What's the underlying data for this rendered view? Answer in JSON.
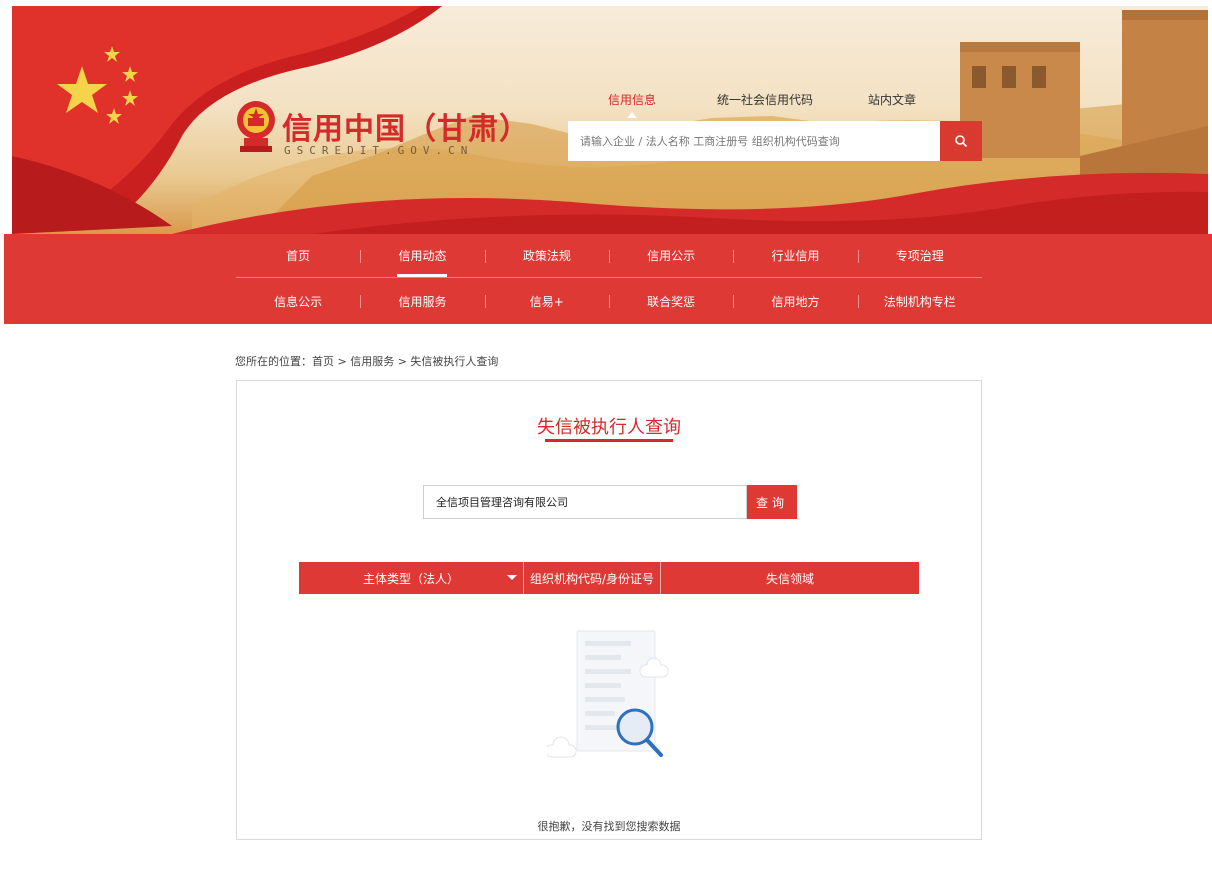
{
  "header": {
    "logo_title": "信用中国（甘肃）",
    "logo_sub": "GSCREDIT.GOV.CN",
    "search_tabs": [
      "信用信息",
      "统一社会信用代码",
      "站内文章"
    ],
    "active_search_tab": "信用信息",
    "search_placeholder": "请输入企业 / 法人名称 工商注册号 组织机构代码查询",
    "search_icon": "search-icon"
  },
  "nav": {
    "row1": [
      "首页",
      "信用动态",
      "政策法规",
      "信用公示",
      "行业信用",
      "专项治理"
    ],
    "row2": [
      "信息公示",
      "信用服务",
      "信易+",
      "联合奖惩",
      "信用地方",
      "法制机构专栏"
    ],
    "active": "信用动态"
  },
  "breadcrumb": "您所在的位置：首页 > 信用服务 > 失信被执行人查询",
  "panel": {
    "title": "失信被执行人查询",
    "query_value": "全信项目管理咨询有限公司",
    "query_button": "查询",
    "columns": [
      "主体类型（法人）",
      "组织机构代码/身份证号",
      "失信领域"
    ],
    "empty_message": "很抱歉，没有找到您搜索数据"
  },
  "colors": {
    "brand_red": "#df3936",
    "title_red": "#d42a2a"
  }
}
